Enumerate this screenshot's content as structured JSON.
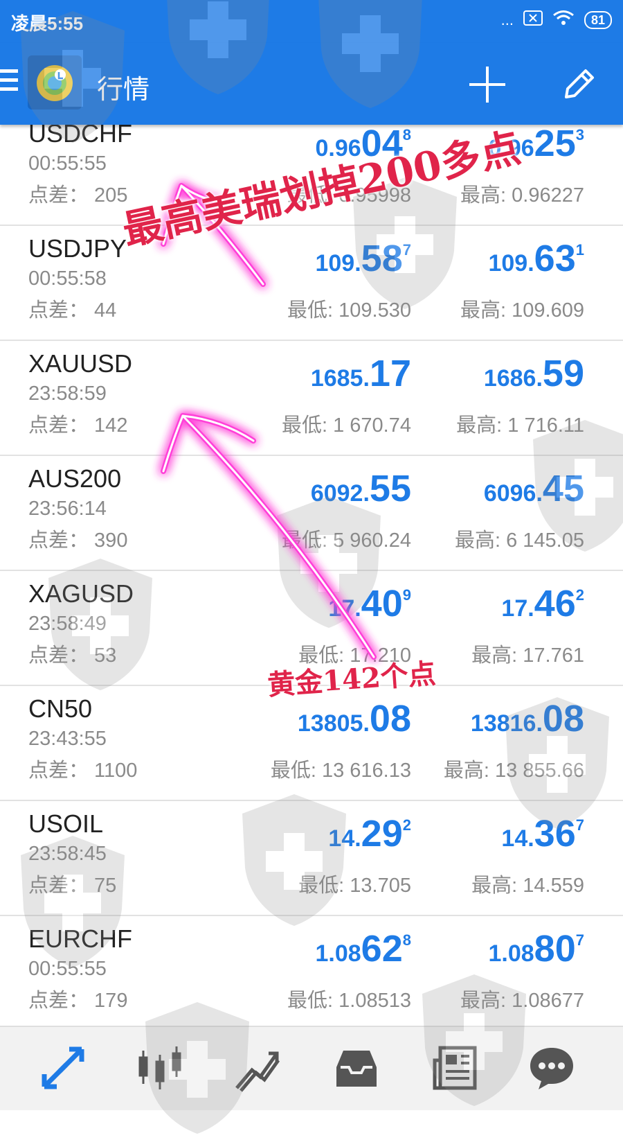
{
  "status_bar": {
    "time": "凌晨5:55",
    "signal": "...",
    "battery": "81"
  },
  "app_bar": {
    "title": "行情"
  },
  "quotes": [
    {
      "symbol": "USDCHF",
      "time": "00:55:55",
      "spread": "点差： 205",
      "bid_small": "0.96",
      "bid_big": "04",
      "bid_sup": "8",
      "ask_small": "0.96",
      "ask_big": "25",
      "ask_sup": "3",
      "low": "最低: 0.95998",
      "high": "最高: 0.96227"
    },
    {
      "symbol": "USDJPY",
      "time": "00:55:58",
      "spread": "点差： 44",
      "bid_small": "109.",
      "bid_big": "58",
      "bid_sup": "7",
      "ask_small": "109.",
      "ask_big": "63",
      "ask_sup": "1",
      "low": "最低: 109.530",
      "high": "最高: 109.609"
    },
    {
      "symbol": "XAUUSD",
      "time": "23:58:59",
      "spread": "点差： 142",
      "bid_small": "1685.",
      "bid_big": "17",
      "bid_sup": "",
      "ask_small": "1686.",
      "ask_big": "59",
      "ask_sup": "",
      "low": "最低: 1 670.74",
      "high": "最高: 1 716.11"
    },
    {
      "symbol": "AUS200",
      "time": "23:56:14",
      "spread": "点差： 390",
      "bid_small": "6092.",
      "bid_big": "55",
      "bid_sup": "",
      "ask_small": "6096.",
      "ask_big": "45",
      "ask_sup": "",
      "low": "最低: 5 960.24",
      "high": "最高: 6 145.05"
    },
    {
      "symbol": "XAGUSD",
      "time": "23:58:49",
      "spread": "点差： 53",
      "bid_small": "17.",
      "bid_big": "40",
      "bid_sup": "9",
      "ask_small": "17.",
      "ask_big": "46",
      "ask_sup": "2",
      "low": "最低: 17.210",
      "high": "最高: 17.761"
    },
    {
      "symbol": "CN50",
      "time": "23:43:55",
      "spread": "点差： 1100",
      "bid_small": "13805.",
      "bid_big": "08",
      "bid_sup": "",
      "ask_small": "13816.",
      "ask_big": "08",
      "ask_sup": "",
      "low": "最低: 13 616.13",
      "high": "最高: 13 855.66"
    },
    {
      "symbol": "USOIL",
      "time": "23:58:45",
      "spread": "点差： 75",
      "bid_small": "14.",
      "bid_big": "29",
      "bid_sup": "2",
      "ask_small": "14.",
      "ask_big": "36",
      "ask_sup": "7",
      "low": "最低: 13.705",
      "high": "最高: 14.559"
    },
    {
      "symbol": "EURCHF",
      "time": "00:55:55",
      "spread": "点差： 179",
      "bid_small": "1.08",
      "bid_big": "62",
      "bid_sup": "8",
      "ask_small": "1.08",
      "ask_big": "80",
      "ask_sup": "7",
      "low": "最低: 1.08513",
      "high": "最高: 1.08677"
    }
  ],
  "annotations": {
    "text1": "最高美瑞划掉200多点",
    "text2": "黄金142个点"
  },
  "nav": [
    "quotes-icon",
    "chart-icon",
    "trade-icon",
    "history-icon",
    "news-icon",
    "chat-icon"
  ],
  "colors": {
    "accent": "#1e7be6",
    "annotation": "#e0244a",
    "glow": "#ff3fd8"
  }
}
